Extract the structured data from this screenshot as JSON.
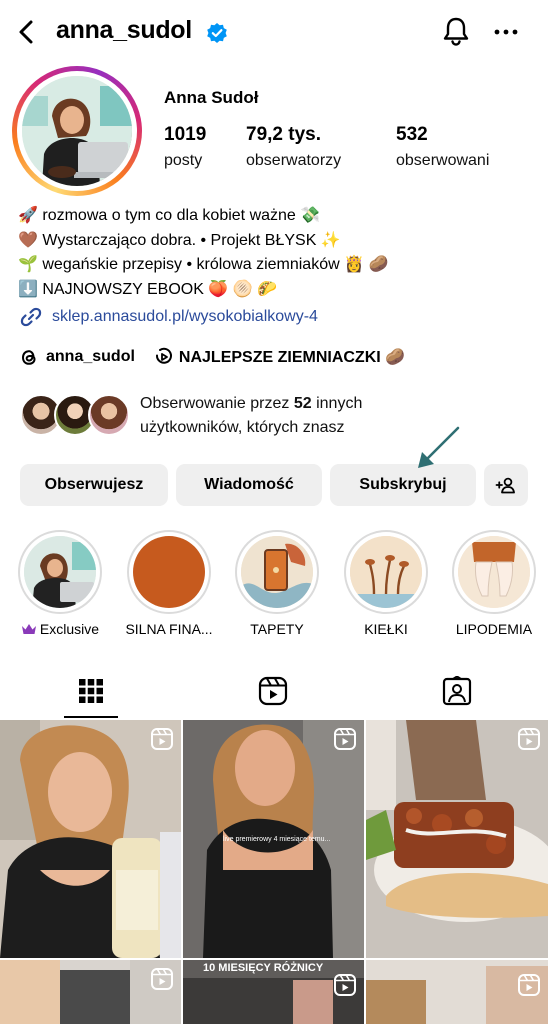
{
  "header": {
    "username": "anna_sudol"
  },
  "profile": {
    "display_name": "Anna Sudoł",
    "stats": [
      {
        "value": "1019",
        "label": "posty"
      },
      {
        "value": "79,2 tys.",
        "label": "obserwatorzy"
      },
      {
        "value": "532",
        "label": "obserwowani"
      }
    ]
  },
  "bio": {
    "lines": [
      "🚀 rozmowa o tym co dla kobiet ważne 💸",
      "🤎 Wystarczająco dobra. • Projekt BŁYSK ✨",
      "🌱 wegańskie przepisy • królowa ziemniaków 👸 🥔",
      "⬇️ NAJNOWSZY EBOOK 🍑 🫓 🌮"
    ],
    "link": "sklep.annasudol.pl/wysokobialkowy-4"
  },
  "threads": {
    "handle": "anna_sudol",
    "reel_collection": "NAJLEPSZE ZIEMNIACZKI 🥔"
  },
  "mutual": {
    "prefix": "Obserwowanie przez ",
    "count": "52",
    "suffix": " innych",
    "line2": "użytkowników, których znasz"
  },
  "buttons": {
    "follow": "Obserwujesz",
    "message": "Wiadomość",
    "subscribe": "Subskrybuj"
  },
  "highlights": [
    {
      "label": "Exclusive",
      "icon": "crown-icon"
    },
    {
      "label": "SILNA FINA..."
    },
    {
      "label": "TAPETY"
    },
    {
      "label": "KIEŁKI"
    },
    {
      "label": "LIPODEMIA"
    }
  ],
  "tabs": [
    "grid-icon",
    "reels-icon",
    "tagged-icon"
  ],
  "grid": {
    "overlay_1": "live premierowy 4 miesiące temu...",
    "overlay_2": "10 MIESIĘCY RÓŻNICY"
  },
  "colors": {
    "link": "#2b4b9b",
    "verified": "#0095f6",
    "button_bg": "#efefef",
    "arrow": "#2f6f73",
    "highlight_orange": "#c65a1e"
  }
}
